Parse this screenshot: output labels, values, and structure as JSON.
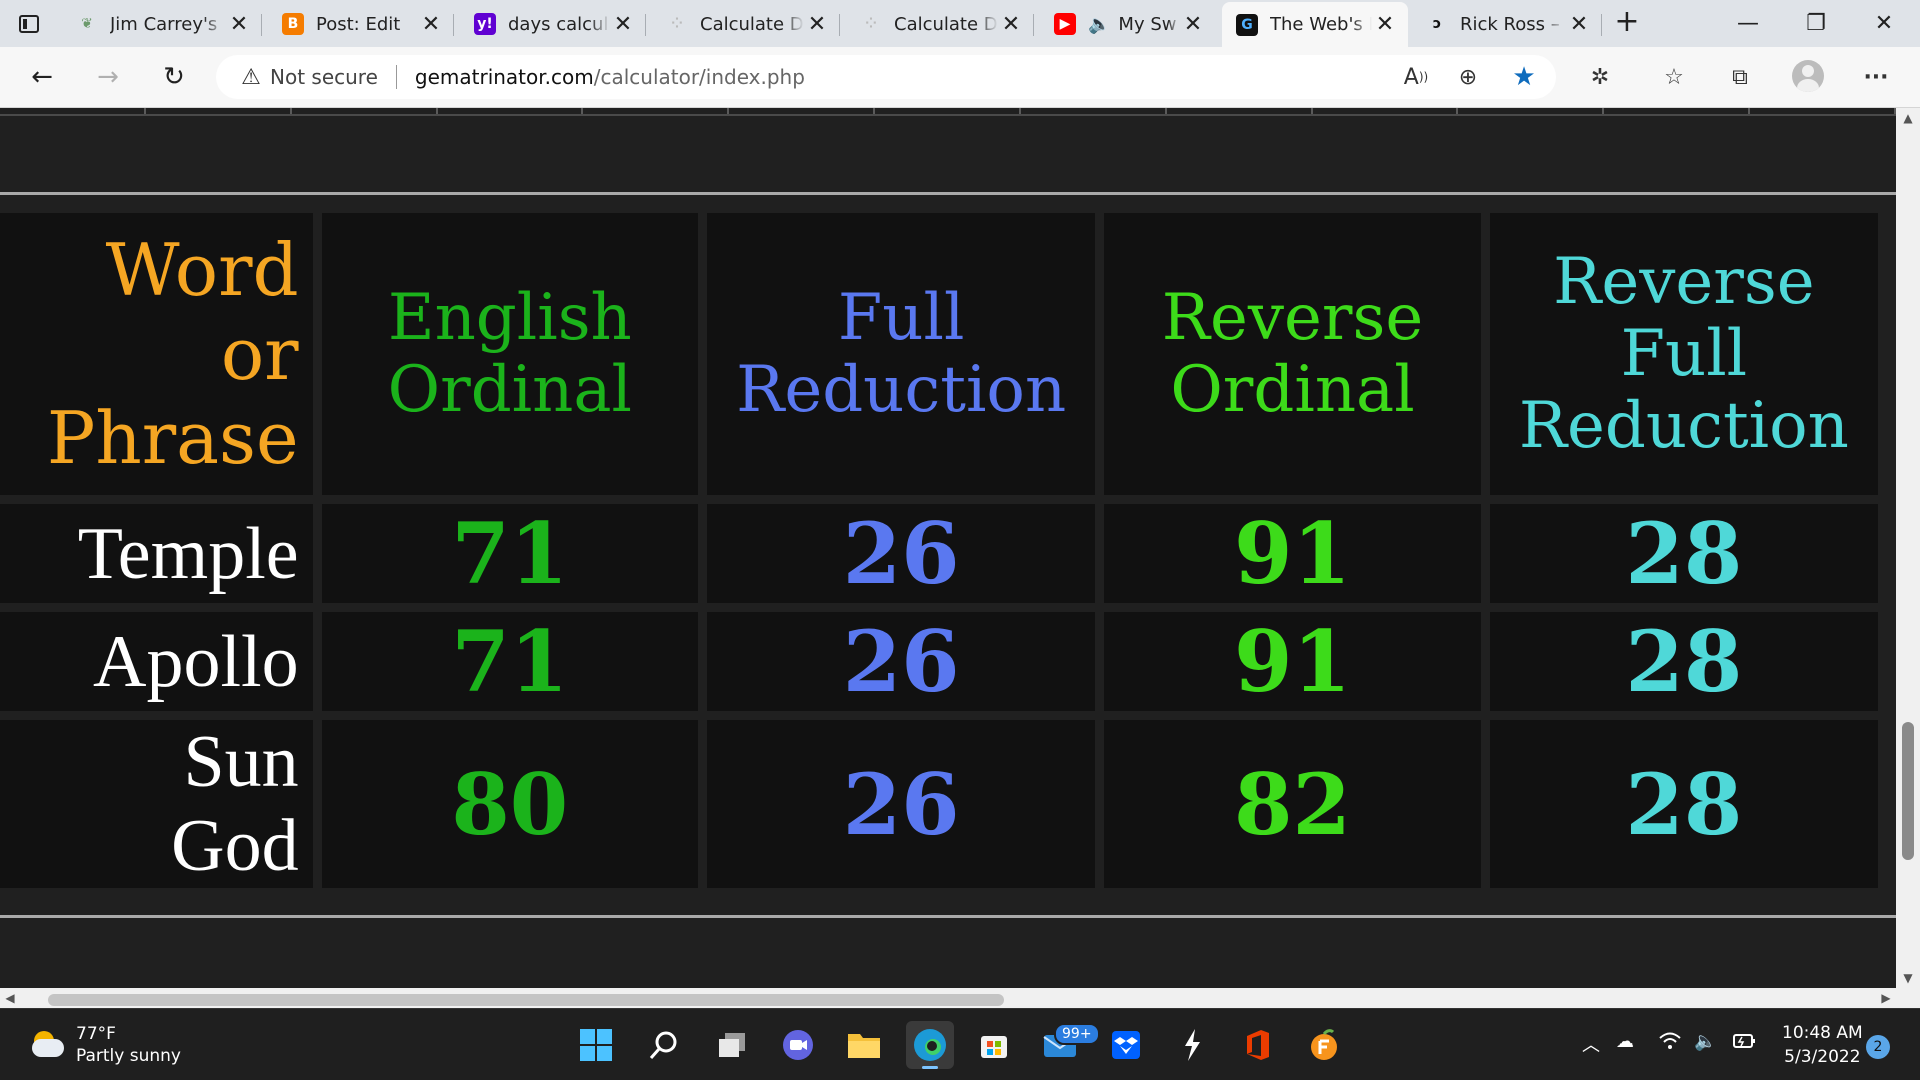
{
  "browser": {
    "tabs": [
      {
        "title": "Jim Carrey's",
        "icon": "leaf-icon",
        "color": "#6c9a6c"
      },
      {
        "title": "Post: Edit",
        "icon": "blogger-icon",
        "color": "#f57c00"
      },
      {
        "title": "days calcula",
        "icon": "yahoo-icon",
        "color": "#6001d2"
      },
      {
        "title": "Calculate D",
        "icon": "calculator-icon",
        "color": "#bbbbbb"
      },
      {
        "title": "Calculate D",
        "icon": "calculator-icon",
        "color": "#bbbbbb"
      },
      {
        "title": "My Sw",
        "icon": "youtube-icon",
        "color": "#ff0000"
      },
      {
        "title": "The Web's I",
        "icon": "gematrinator-icon",
        "color": "#111111"
      },
      {
        "title": "Rick Ross –",
        "icon": "genius-icon",
        "color": "#111111"
      }
    ],
    "active_tab": 6,
    "address": {
      "security": "Not secure",
      "host": "gematrinator.com",
      "path": "/calculator/index.php"
    }
  },
  "table": {
    "headers": [
      {
        "lines": [
          "Word",
          "or",
          "Phrase"
        ],
        "color": "#f5a623"
      },
      {
        "lines": [
          "English",
          "Ordinal"
        ],
        "color": "#1bb31b"
      },
      {
        "lines": [
          "Full",
          "Reduction"
        ],
        "color": "#5a78f0"
      },
      {
        "lines": [
          "Reverse",
          "Ordinal"
        ],
        "color": "#3ddb1a"
      },
      {
        "lines": [
          "Reverse",
          "Full",
          "Reduction"
        ],
        "color": "#4fd8d8"
      }
    ],
    "rows": [
      {
        "phrase": [
          "Temple"
        ],
        "values": [
          "71",
          "26",
          "91",
          "28"
        ]
      },
      {
        "phrase": [
          "Apollo"
        ],
        "values": [
          "71",
          "26",
          "91",
          "28"
        ]
      },
      {
        "phrase": [
          "Sun",
          "God"
        ],
        "values": [
          "80",
          "26",
          "82",
          "28"
        ]
      }
    ],
    "value_colors": [
      "#1bb31b",
      "#5a78f0",
      "#3ddb1a",
      "#4fd8d8"
    ]
  },
  "taskbar": {
    "weather": {
      "temp": "77°F",
      "condition": "Partly sunny"
    },
    "mail_badge": "99+",
    "time": "10:48 AM",
    "date": "5/3/2022",
    "notifications": "2"
  }
}
